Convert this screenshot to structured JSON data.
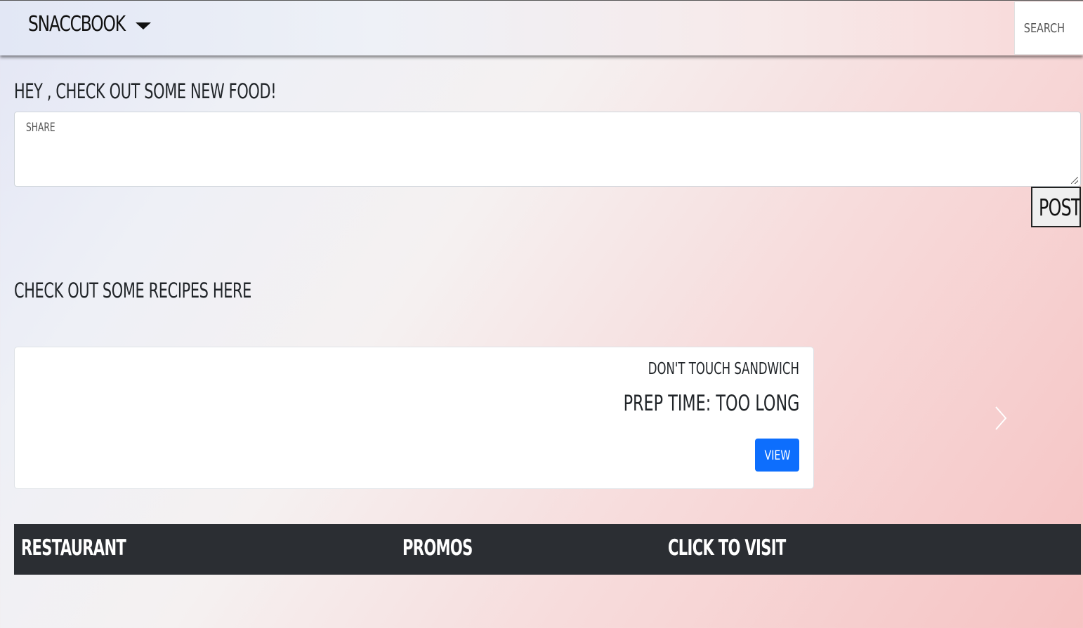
{
  "navbar": {
    "brand": "SNACCBOOK",
    "search_placeholder": "SEARCH"
  },
  "feed": {
    "greeting": "HEY , CHECK OUT SOME NEW FOOD!",
    "share_placeholder": "SHARE",
    "post_label": "POST"
  },
  "recipes": {
    "heading": "CHECK OUT SOME RECIPES HERE",
    "card": {
      "title": "DON'T TOUCH SANDWICH",
      "prep_time": "PREP TIME: TOO LONG",
      "view_label": "VIEW"
    }
  },
  "restaurants_table": {
    "columns": [
      "RESTAURANT",
      "PROMOS",
      "CLICK TO VISIT"
    ]
  },
  "colors": {
    "accent": "#0d6efd",
    "table_header": "#2b2e33"
  },
  "icons": {
    "brand_dropdown": "caret-down-icon",
    "carousel_next": "chevron-right-icon"
  }
}
